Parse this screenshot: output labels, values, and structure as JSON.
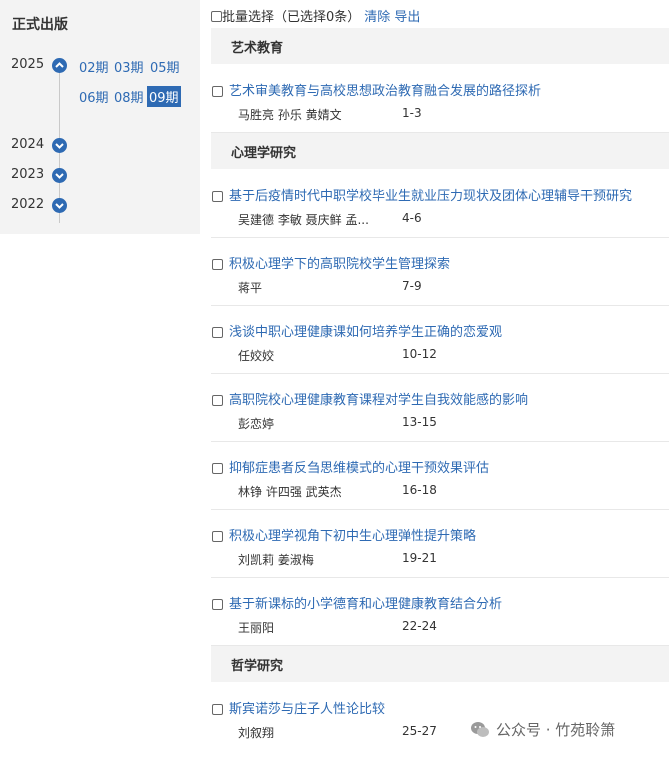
{
  "sidebar": {
    "title": "正式出版",
    "years": [
      {
        "year": "2025",
        "expanded": true
      },
      {
        "year": "2024",
        "expanded": false
      },
      {
        "year": "2023",
        "expanded": false
      },
      {
        "year": "2022",
        "expanded": false
      }
    ],
    "issues": [
      "02期",
      "03期",
      "05期",
      "06期",
      "08期",
      "09期"
    ],
    "selected_issue": "09期"
  },
  "toolbar": {
    "batch_label": "批量选择",
    "selected_count": "（已选择0条）",
    "clear_label": "清除",
    "export_label": "导出"
  },
  "sections": [
    {
      "name": "艺术教育",
      "articles": [
        {
          "title": "艺术审美教育与高校思想政治教育融合发展的路径探析",
          "authors": "马胜亮 孙乐 黄婧文",
          "pages": "1-3"
        }
      ]
    },
    {
      "name": "心理学研究",
      "articles": [
        {
          "title": "基于后疫情时代中职学校毕业生就业压力现状及团体心理辅导干预研究",
          "authors": "吴建德 李敏 聂庆鲜 孟...",
          "pages": "4-6"
        },
        {
          "title": "积极心理学下的高职院校学生管理探索",
          "authors": "蒋平",
          "pages": "7-9"
        },
        {
          "title": "浅谈中职心理健康课如何培养学生正确的恋爱观",
          "authors": "任姣姣",
          "pages": "10-12"
        },
        {
          "title": "高职院校心理健康教育课程对学生自我效能感的影响",
          "authors": "彭恋婷",
          "pages": "13-15"
        },
        {
          "title": "抑郁症患者反刍思维模式的心理干预效果评估",
          "authors": "林铮 许四强 武英杰",
          "pages": "16-18"
        },
        {
          "title": "积极心理学视角下初中生心理弹性提升策略",
          "authors": "刘凯莉 姜淑梅",
          "pages": "19-21"
        },
        {
          "title": "基于新课标的小学德育和心理健康教育结合分析",
          "authors": "王丽阳",
          "pages": "22-24"
        }
      ]
    },
    {
      "name": "哲学研究",
      "articles": [
        {
          "title": "斯宾诺莎与庄子人性论比较",
          "authors": "刘叙翔",
          "pages": "25-27"
        }
      ]
    }
  ],
  "watermark": {
    "text": "公众号 · 竹苑聆箫"
  },
  "colors": {
    "accent": "#2e6ab3",
    "panel_bg": "#f3f3f3"
  }
}
